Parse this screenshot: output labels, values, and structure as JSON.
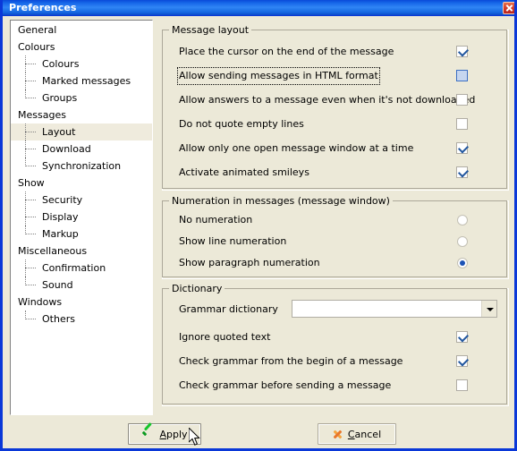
{
  "window": {
    "title": "Preferences",
    "close_icon": "close-icon",
    "titlebar_color": "#1565e8",
    "border_color": "#0a38d8",
    "face_color": "#ece9d8"
  },
  "sidebar": {
    "items": [
      {
        "label": "General",
        "level": 0,
        "selected": false,
        "last": false
      },
      {
        "label": "Colours",
        "level": 0,
        "selected": false,
        "last": false
      },
      {
        "label": "Colours",
        "level": 1,
        "selected": false,
        "last": false
      },
      {
        "label": "Marked messages",
        "level": 1,
        "selected": false,
        "last": false
      },
      {
        "label": "Groups",
        "level": 1,
        "selected": false,
        "last": true
      },
      {
        "label": "Messages",
        "level": 0,
        "selected": false,
        "last": false
      },
      {
        "label": "Layout",
        "level": 1,
        "selected": true,
        "last": false
      },
      {
        "label": "Download",
        "level": 1,
        "selected": false,
        "last": false
      },
      {
        "label": "Synchronization",
        "level": 1,
        "selected": false,
        "last": true
      },
      {
        "label": "Show",
        "level": 0,
        "selected": false,
        "last": false
      },
      {
        "label": "Security",
        "level": 1,
        "selected": false,
        "last": false
      },
      {
        "label": "Display",
        "level": 1,
        "selected": false,
        "last": false
      },
      {
        "label": "Markup",
        "level": 1,
        "selected": false,
        "last": true
      },
      {
        "label": "Miscellaneous",
        "level": 0,
        "selected": false,
        "last": false
      },
      {
        "label": "Confirmation",
        "level": 1,
        "selected": false,
        "last": false
      },
      {
        "label": "Sound",
        "level": 1,
        "selected": false,
        "last": true
      },
      {
        "label": "Windows",
        "level": 0,
        "selected": false,
        "last": false
      },
      {
        "label": "Others",
        "level": 1,
        "selected": false,
        "last": true
      }
    ],
    "selection_color": "#efebdd"
  },
  "groups": {
    "message_layout": {
      "title": "Message layout",
      "options": [
        {
          "label": "Place the cursor on the end of the message",
          "checked": true,
          "focused": false,
          "hot": false
        },
        {
          "label": "Allow sending messages in HTML format",
          "checked": false,
          "focused": true,
          "hot": true
        },
        {
          "label": "Allow answers to a message even when it's not downloaded",
          "checked": false,
          "focused": false,
          "hot": false
        },
        {
          "label": "Do not quote empty lines",
          "checked": false,
          "focused": false,
          "hot": false
        },
        {
          "label": "Allow only one open message window at a time",
          "checked": true,
          "focused": false,
          "hot": false
        },
        {
          "label": "Activate animated smileys",
          "checked": true,
          "focused": false,
          "hot": false
        }
      ]
    },
    "numeration": {
      "title": "Numeration in messages (message window)",
      "options": [
        {
          "label": "No numeration",
          "selected": false
        },
        {
          "label": "Show line numeration",
          "selected": false
        },
        {
          "label": "Show paragraph numeration",
          "selected": true
        }
      ]
    },
    "dictionary": {
      "title": "Dictionary",
      "combo": {
        "label": "Grammar dictionary",
        "value": "",
        "arrow_icon": "chevron-down-icon"
      },
      "options": [
        {
          "label": "Ignore quoted text",
          "checked": true
        },
        {
          "label": "Check grammar from the begin of a message",
          "checked": true
        },
        {
          "label": "Check grammar before sending a message",
          "checked": false
        }
      ]
    }
  },
  "buttons": {
    "apply": {
      "label_pre": "",
      "accel": "A",
      "label_post": "pply",
      "icon": "green-check-icon",
      "is_default": true
    },
    "cancel": {
      "label_pre": "",
      "accel": "C",
      "label_post": "ancel",
      "icon": "orange-x-icon",
      "is_default": false
    }
  }
}
